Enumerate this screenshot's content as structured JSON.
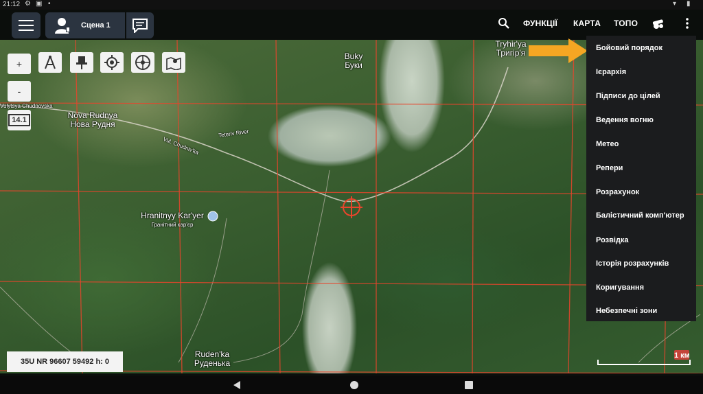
{
  "status": {
    "time": "21:12"
  },
  "toolbar": {
    "scene_label": "Сцена 1",
    "links": [
      "ФУНКЦІЇ",
      "КАРТА",
      "ТОПО"
    ]
  },
  "map_tools": {
    "zoom_in": "+",
    "zoom_out": "-",
    "zoom_level": "14.1"
  },
  "map_labels": {
    "nova_rudnya_lat": "Nova Rudnya",
    "nova_rudnya_cyr": "Нова Рудня",
    "buky_lat": "Buky",
    "buky_cyr": "Буки",
    "tryhiria_lat": "Tryhir'ya",
    "tryhiria_cyr": "Тригір'я",
    "street_1": "Vulytsya Chudnovska",
    "street_2": "Vul. Chudniv'ka",
    "river": "Teteriv River",
    "quarry_lat": "Hranitnyy Kar'yer",
    "quarry_cyr": "Гранітний кар'єр",
    "rudenka_lat": "Ruden'ka",
    "rudenka_cyr": "Руденька"
  },
  "dropdown": {
    "items": [
      "Бойовий порядок",
      "Ієрархія",
      "Підписи до цілей",
      "Ведення вогню",
      "Метео",
      "Репери",
      "Розрахунок",
      "Балістичний комп'ютер",
      "Розвідка",
      "Історія розрахунків",
      "Коригування",
      "Небезпечні зони"
    ]
  },
  "coordinates": "35U NR 96607 59492 h: 0",
  "scale_label": "1 км",
  "colors": {
    "grid": "#e8452c",
    "arrow": "#f5a623",
    "panel": "#1b1c1e",
    "button": "#2b3440"
  },
  "icons": [
    "gear-icon",
    "image-icon",
    "menu-icon",
    "user-icon",
    "chat-icon",
    "search-icon",
    "cannon-icon",
    "more-vert-icon",
    "ruler-compass-icon",
    "pin-icon",
    "locate-icon",
    "compass-icon",
    "map-icon",
    "crosshair-icon",
    "back-icon",
    "home-icon",
    "recents-icon"
  ]
}
